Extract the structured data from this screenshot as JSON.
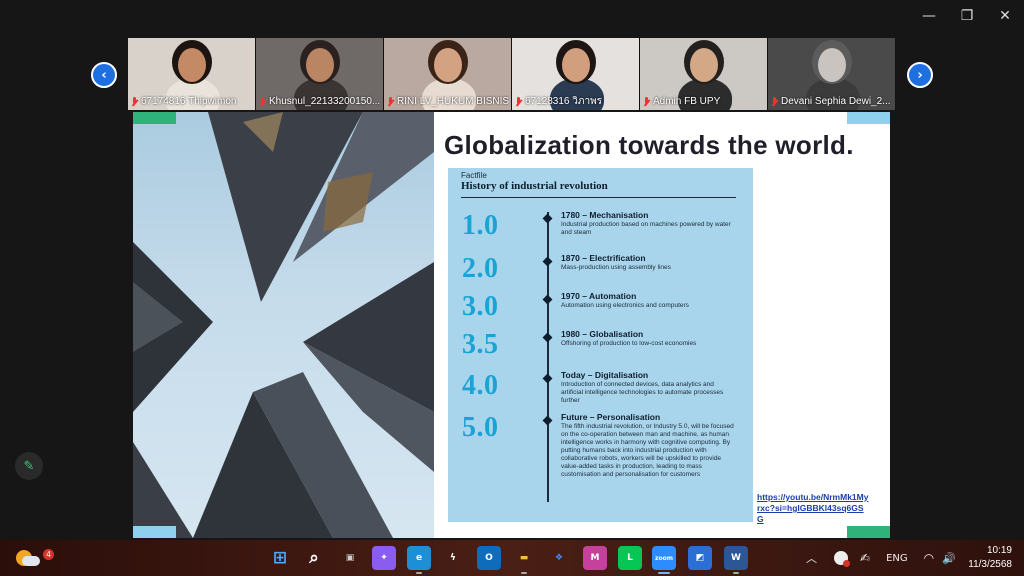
{
  "window": {
    "controls": [
      "—",
      "❐",
      "✕"
    ]
  },
  "participants": [
    {
      "name": "67174816 Thipwimon",
      "muted": true,
      "bg": "#d8d2cb",
      "skin": "#c48a66",
      "hair": "#1c1410",
      "shirt": "#e9e3dc"
    },
    {
      "name": "Khusnul_22133200150...",
      "muted": true,
      "bg": "#6f6a68",
      "skin": "#b98563",
      "hair": "#2a2020",
      "shirt": "#3a3433"
    },
    {
      "name": "RINI LV_HUKUM BISNIS",
      "muted": true,
      "bg": "#b9a9a1",
      "skin": "#d3a282",
      "hair": "#3a2418",
      "shirt": "#e8dcd2"
    },
    {
      "name": "67128316 วิภาพร",
      "muted": true,
      "bg": "#e4e1de",
      "skin": "#d19e7e",
      "hair": "#1e1612",
      "shirt": "#2a3b52"
    },
    {
      "name": "Admin FB UPY",
      "muted": true,
      "bg": "#ccc8c4",
      "skin": "#d2a887",
      "hair": "#23211f",
      "shirt": "#2c2c2c"
    },
    {
      "name": "Devani Sephia Dewi_2...",
      "muted": true,
      "bg": "#4a4a4a",
      "skin": "#c9c4bf",
      "hair": "#5b5b5b",
      "shirt": "#3b3b3b"
    }
  ],
  "nav": {
    "prev": "‹",
    "next": "›"
  },
  "slide": {
    "title": "Globalization towards the world.",
    "factfile_label": "Factfile",
    "heading": "History of industrial revolution",
    "entries": [
      {
        "version": "1.0",
        "title": "1780 – Mechanisation",
        "desc": "Industrial production based on machines powered by water and steam"
      },
      {
        "version": "2.0",
        "title": "1870 – Electrification",
        "desc": "Mass-production using assembly lines"
      },
      {
        "version": "3.0",
        "title": "1970 – Automation",
        "desc": "Automation using electronics and computers"
      },
      {
        "version": "3.5",
        "title": "1980 – Globalisation",
        "desc": "Offshoring of production to low-cost economies"
      },
      {
        "version": "4.0",
        "title": "Today – Digitalisation",
        "desc": "Introduction of connected devices, data analytics and artificial intelligence technologies to automate processes further"
      },
      {
        "version": "5.0",
        "title": "Future – Personalisation",
        "desc": "The fifth industrial revolution, or Industry 5.0, will be focused on the co-operation between man and machine, as human intelligence works in harmony with cognitive computing. By putting humans back into industrial production with collaborative robots, workers will be upskilled to provide value-added tasks in production, leading to mass customisation and personalisation for customers"
      }
    ],
    "link": "https://youtu.be/NrmMk1Myrxc?si=hgIGBBKl43sq6GSG"
  },
  "taskbar": {
    "weather_badge": "4",
    "apps": [
      {
        "name": "start-icon",
        "glyph": "⊞",
        "color": "#4aa8ff",
        "bg": "transparent"
      },
      {
        "name": "search-icon",
        "glyph": "⌕",
        "color": "#ffffff",
        "bg": "transparent"
      },
      {
        "name": "task-view-icon",
        "glyph": "▣",
        "color": "#cfcfcf",
        "bg": "transparent"
      },
      {
        "name": "copilot-icon",
        "glyph": "✦",
        "color": "#ffffff",
        "bg": "#8a5cf0"
      },
      {
        "name": "edge-icon",
        "glyph": "e",
        "color": "#ffffff",
        "bg": "#1d8fd6"
      },
      {
        "name": "app-lightning-icon",
        "glyph": "ϟ",
        "color": "#ffffff",
        "bg": "transparent"
      },
      {
        "name": "outlook-icon",
        "glyph": "O",
        "color": "#ffffff",
        "bg": "#0f6cbd"
      },
      {
        "name": "file-explorer-icon",
        "glyph": "▬",
        "color": "#f3c23a",
        "bg": "transparent"
      },
      {
        "name": "dropbox-icon",
        "glyph": "❖",
        "color": "#3d8bff",
        "bg": "transparent"
      },
      {
        "name": "microsoft365-icon",
        "glyph": "M",
        "color": "#ffffff",
        "bg": "#c5419b"
      },
      {
        "name": "line-icon",
        "glyph": "L",
        "color": "#ffffff",
        "bg": "#06c755"
      },
      {
        "name": "zoom-icon",
        "glyph": "zoom",
        "color": "#ffffff",
        "bg": "#2d8cff"
      },
      {
        "name": "photos-icon",
        "glyph": "◩",
        "color": "#ffffff",
        "bg": "#2b6fd6"
      },
      {
        "name": "word-icon",
        "glyph": "W",
        "color": "#ffffff",
        "bg": "#2b5797"
      }
    ],
    "tray": {
      "chevron": "︿",
      "lang": "ENG",
      "wifi": "◠",
      "volume": "🔊"
    },
    "time": "10:19",
    "date": "11/3/2568"
  }
}
